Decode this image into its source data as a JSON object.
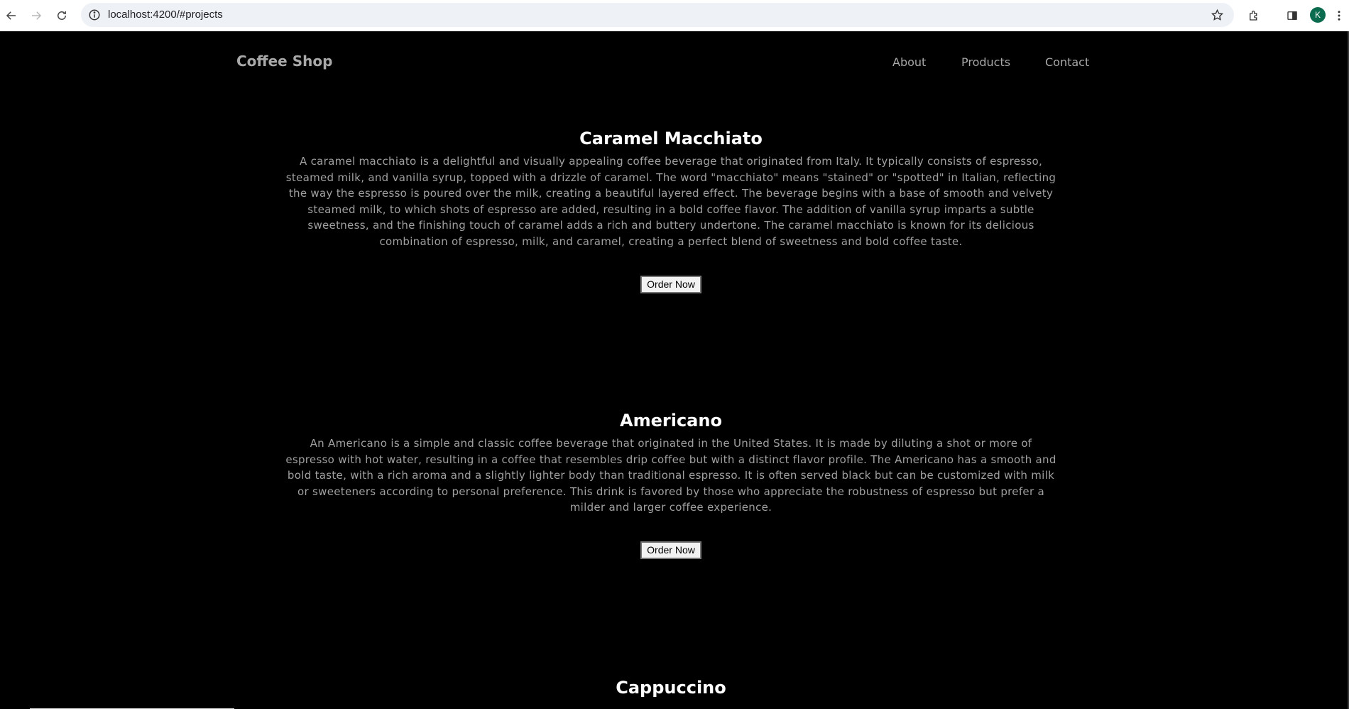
{
  "browser": {
    "url": "localhost:4200/#projects",
    "profile_initial": "K",
    "icons": [
      "back-arrow-icon",
      "forward-arrow-icon",
      "reload-icon",
      "info-icon",
      "star-icon",
      "extensions-icon",
      "side-panel-icon",
      "kebab-menu-icon"
    ]
  },
  "site": {
    "brand": "Coffee Shop",
    "nav": {
      "about": "About",
      "products": "Products",
      "contact": "Contact"
    }
  },
  "products": [
    {
      "name": "Caramel Macchiato",
      "description": "A caramel macchiato is a delightful and visually appealing coffee beverage that originated from Italy. It typically consists of espresso, steamed milk, and vanilla syrup, topped with a drizzle of caramel. The word \"macchiato\" means \"stained\" or \"spotted\" in Italian, reflecting the way the espresso is poured over the milk, creating a beautiful layered effect. The beverage begins with a base of smooth and velvety steamed milk, to which shots of espresso are added, resulting in a bold coffee flavor. The addition of vanilla syrup imparts a subtle sweetness, and the finishing touch of caramel adds a rich and buttery undertone. The caramel macchiato is known for its delicious combination of espresso, milk, and caramel, creating a perfect blend of sweetness and bold coffee taste.",
      "button": "Order Now"
    },
    {
      "name": "Americano",
      "description": "An Americano is a simple and classic coffee beverage that originated in the United States. It is made by diluting a shot or more of espresso with hot water, resulting in a coffee that resembles drip coffee but with a distinct flavor profile. The Americano has a smooth and bold taste, with a rich aroma and a slightly lighter body than traditional espresso. It is often served black but can be customized with milk or sweeteners according to personal preference. This drink is favored by those who appreciate the robustness of espresso but prefer a milder and larger coffee experience.",
      "button": "Order Now"
    },
    {
      "name": "Cappuccino"
    }
  ],
  "colors": {
    "page_background": "#000000",
    "heading": "#ffffff",
    "body_text": "#a0a0a0",
    "nav_text": "#a9a9a9",
    "omnibox": "#eef1f6"
  }
}
